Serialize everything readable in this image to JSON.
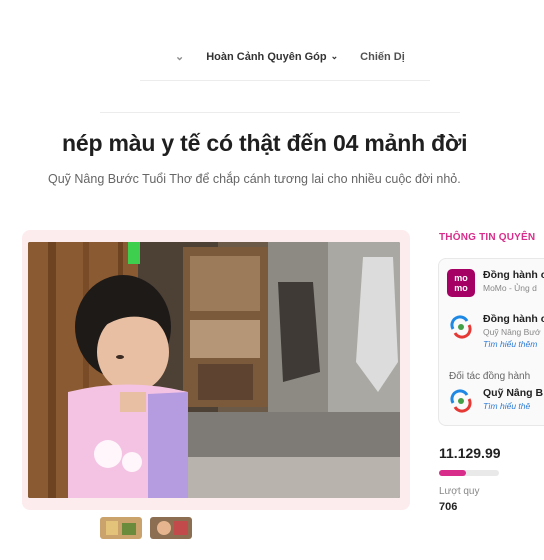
{
  "nav": {
    "items": [
      {
        "label": "Hoàn Cảnh Quyên Góp"
      },
      {
        "label": "Chiến Dị"
      }
    ]
  },
  "campaign": {
    "title": "nép màu y tế có thật đến 04 mảnh đời",
    "subtitle": "Quỹ Nâng Bước Tuổi Thơ để chắp cánh tương lai cho nhiều cuộc đời nhỏ."
  },
  "sidebar": {
    "heading": "THÔNG TIN QUYÊN",
    "companions": [
      {
        "name": "Đồng hành c",
        "sub": "MoMo - Ủng d",
        "logo": "momo-logo"
      },
      {
        "name": "Đồng hành c",
        "sub": "Quỹ Nâng Bướ",
        "more": "Tìm hiểu thêm",
        "logo": "fund-logo"
      }
    ],
    "partner_label": "Đối tác đồng hành",
    "partner": {
      "name": "Quỹ Nâng B",
      "more": "Tìm hiểu thê",
      "logo": "fund-logo"
    },
    "amount": "11.129.99",
    "progress": 0.45,
    "donations_label": "Lượt quy",
    "donations_count": "706"
  },
  "momo_logo_text": "mo mo",
  "colors": {
    "accent": "#d82d8b",
    "momo": "#a50064",
    "link": "#2e7bd6"
  }
}
